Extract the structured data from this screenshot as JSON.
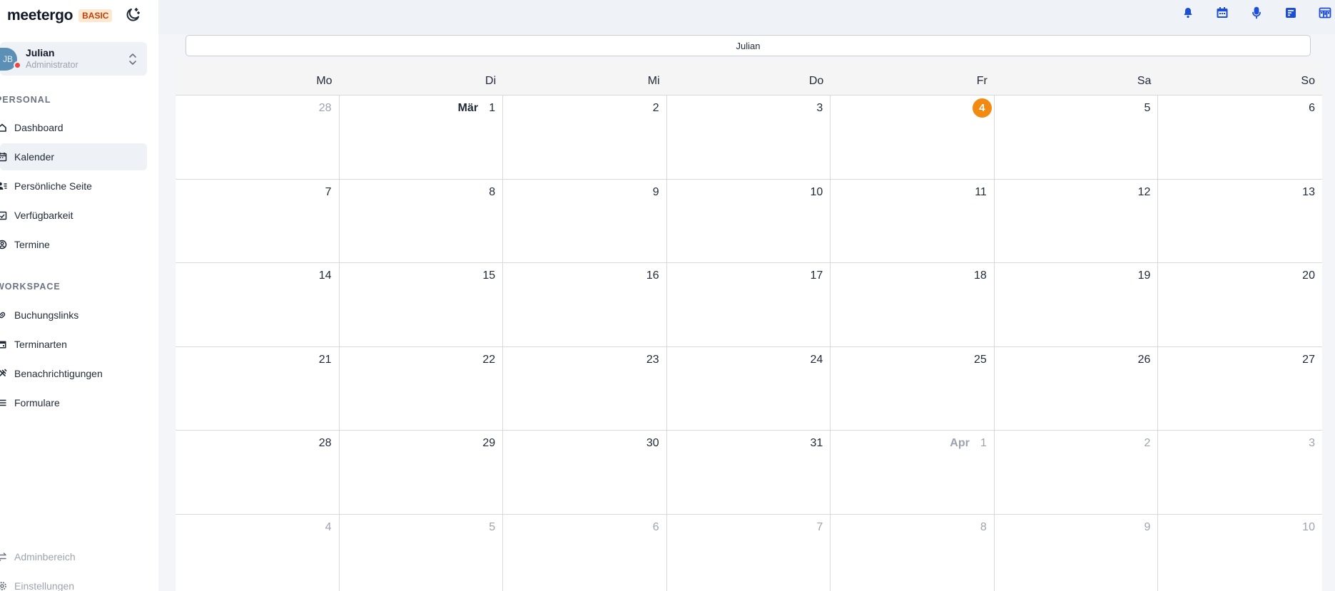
{
  "brand": {
    "name": "meetergo",
    "badge": "BASIC"
  },
  "user": {
    "initials": "JB",
    "name": "Julian",
    "role": "Administrator"
  },
  "sidebar": {
    "personal_label": "PERSONAL",
    "personal_items": [
      {
        "label": "Dashboard",
        "icon": "home-icon"
      },
      {
        "label": "Kalender",
        "icon": "calendar-icon",
        "active": true
      },
      {
        "label": "Persönliche Seite",
        "icon": "user-page-icon"
      },
      {
        "label": "Verfügbarkeit",
        "icon": "calendar-check-icon"
      },
      {
        "label": "Termine",
        "icon": "user-circle-icon"
      }
    ],
    "workspace_label": "WORKSPACE",
    "workspace_items": [
      {
        "label": "Buchungslinks",
        "icon": "link-icon"
      },
      {
        "label": "Terminarten",
        "icon": "calendar-event-icon"
      },
      {
        "label": "Benachrichtigungen",
        "icon": "notification-icon"
      },
      {
        "label": "Formulare",
        "icon": "list-icon"
      }
    ],
    "bottom_items": [
      {
        "label": "Adminbereich",
        "icon": "swap-icon"
      },
      {
        "label": "Einstellungen",
        "icon": "gear-icon"
      }
    ]
  },
  "topbar_icons": [
    "bell-icon",
    "calendar-icon",
    "microphone-icon",
    "form-icon",
    "board-icon"
  ],
  "accent_color": "#f28a12",
  "calendar": {
    "filter_value": "Julian",
    "weekdays": [
      "Mo",
      "Di",
      "Mi",
      "Do",
      "Fr",
      "Sa",
      "So"
    ],
    "weeks": [
      [
        {
          "d": "28",
          "dim": true
        },
        {
          "d": "1",
          "month": "Mär"
        },
        {
          "d": "2"
        },
        {
          "d": "3"
        },
        {
          "d": "4",
          "today": true
        },
        {
          "d": "5"
        },
        {
          "d": "6"
        }
      ],
      [
        {
          "d": "7"
        },
        {
          "d": "8"
        },
        {
          "d": "9"
        },
        {
          "d": "10"
        },
        {
          "d": "11"
        },
        {
          "d": "12"
        },
        {
          "d": "13"
        }
      ],
      [
        {
          "d": "14"
        },
        {
          "d": "15"
        },
        {
          "d": "16"
        },
        {
          "d": "17"
        },
        {
          "d": "18"
        },
        {
          "d": "19"
        },
        {
          "d": "20"
        }
      ],
      [
        {
          "d": "21"
        },
        {
          "d": "22"
        },
        {
          "d": "23"
        },
        {
          "d": "24"
        },
        {
          "d": "25"
        },
        {
          "d": "26"
        },
        {
          "d": "27"
        }
      ],
      [
        {
          "d": "28"
        },
        {
          "d": "29"
        },
        {
          "d": "30"
        },
        {
          "d": "31"
        },
        {
          "d": "1",
          "month": "Apr",
          "dim": true
        },
        {
          "d": "2",
          "dim": true
        },
        {
          "d": "3",
          "dim": true
        }
      ],
      [
        {
          "d": "4",
          "dim": true
        },
        {
          "d": "5",
          "dim": true
        },
        {
          "d": "6",
          "dim": true
        },
        {
          "d": "7",
          "dim": true
        },
        {
          "d": "8",
          "dim": true
        },
        {
          "d": "9",
          "dim": true
        },
        {
          "d": "10",
          "dim": true
        }
      ]
    ]
  }
}
